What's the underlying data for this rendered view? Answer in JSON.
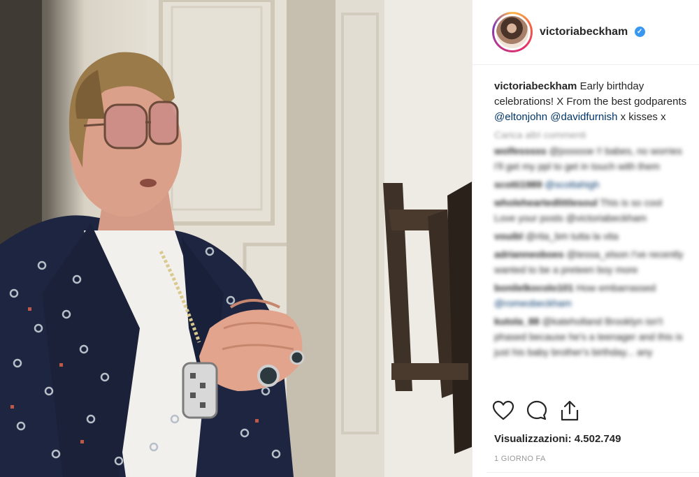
{
  "post": {
    "username": "victoriabeckham",
    "caption": {
      "author": "victoriabeckham",
      "line1": "Early birthday",
      "line2": "celebrations! X From the best godparents",
      "mention1": "@eltonjohn",
      "mention2": "@davidfurnish",
      "tail": "x kisses x"
    },
    "load_more": "Carica altri commenti",
    "comments": [
      {
        "user": "wolfesssss",
        "text": "@joooooe !! babes, no worries",
        "text2": "I'll get my ppl to get in touch with them"
      },
      {
        "user": "scotti1989",
        "text": "@scottahigh"
      },
      {
        "user": "wholeheartedlittlesoul",
        "text": "This is so cool",
        "text2": "Love your posts @victoriabeckham"
      },
      {
        "user": "vouibl",
        "text": "@rita_bm tutta la vita"
      },
      {
        "user": "adrianneoboes",
        "text": "@tessa_elson I've recently",
        "text2": "wanted to be a preteen boy more"
      },
      {
        "user": "bonilelkocolo101",
        "text": "How embarrassed",
        "text2": "@romeobeckham"
      },
      {
        "user": "kutola_88",
        "text": "@kateholland Brooklyn isn't",
        "text2": "phased because he's a teenager and this is",
        "text3": "just his baby brother's birthday... any"
      }
    ],
    "views_label": "Visualizzazioni:",
    "views_count": "4.502.749",
    "date": "1 GIORNO FA"
  },
  "icons": {
    "verified": "verified-badge-icon",
    "like": "heart-icon",
    "comment": "comment-bubble-icon",
    "share": "share-icon"
  },
  "colors": {
    "verified_blue": "#3897f0",
    "text": "#262626",
    "muted": "#999999"
  }
}
